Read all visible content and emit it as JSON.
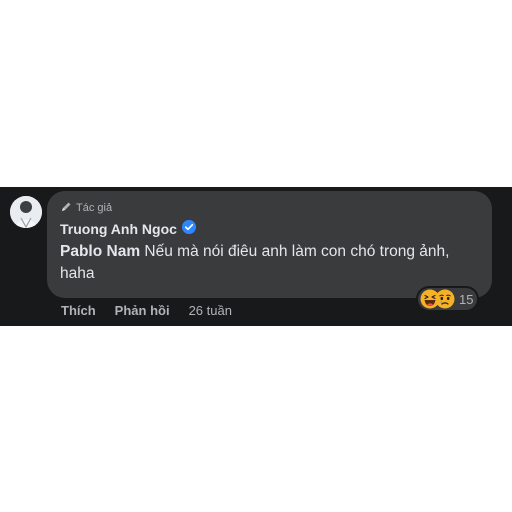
{
  "comment": {
    "role_badge": "Tác giả",
    "author": "Truong Anh Ngoc",
    "mention": "Pablo Nam",
    "text": " Nếu mà nói điêu anh làm con chó trong ảnh, haha",
    "reactions": {
      "icons": [
        "haha-reaction-icon",
        "sad-reaction-icon"
      ],
      "count": "15"
    },
    "actions": {
      "like_label": "Thích",
      "reply_label": "Phản hồi",
      "time": "26 tuần"
    }
  },
  "colors": {
    "background": "#18191a",
    "bubble": "#3a3b3c",
    "text_primary": "#e4e6eb",
    "text_secondary": "#b0b3b8",
    "verified": "#2d88ff"
  }
}
